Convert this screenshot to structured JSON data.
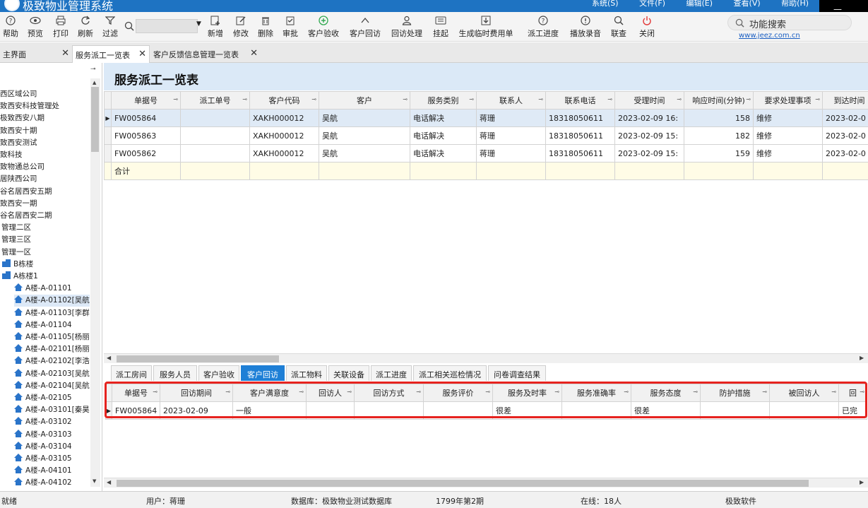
{
  "titlebar": {
    "app_title": "极致物业管理系统",
    "menu": [
      "系统(S)",
      "文件(F)",
      "编辑(E)",
      "查看(V)",
      "帮助(H)"
    ]
  },
  "toolbar": {
    "items": [
      {
        "label": "帮助",
        "icon": "help-icon"
      },
      {
        "label": "预览",
        "icon": "preview-icon"
      },
      {
        "label": "打印",
        "icon": "print-icon"
      },
      {
        "label": "刷新",
        "icon": "refresh-icon"
      },
      {
        "label": "过滤",
        "icon": "filter-icon"
      },
      {
        "label": "新增",
        "icon": "add-icon"
      },
      {
        "label": "修改",
        "icon": "edit-icon"
      },
      {
        "label": "删除",
        "icon": "delete-icon"
      },
      {
        "label": "审批",
        "icon": "approve-icon"
      },
      {
        "label": "客户验收",
        "icon": "plus-circle-icon"
      },
      {
        "label": "客户回访",
        "icon": "chevron-up-icon"
      },
      {
        "label": "回访处理",
        "icon": "user-icon"
      },
      {
        "label": "挂起",
        "icon": "keyboard-icon"
      },
      {
        "label": "生成临时费用单",
        "icon": "download-icon"
      },
      {
        "label": "派工进度",
        "icon": "help-icon"
      },
      {
        "label": "播放录音",
        "icon": "info-icon"
      },
      {
        "label": "联查",
        "icon": "search-icon"
      },
      {
        "label": "关闭",
        "icon": "power-icon"
      }
    ],
    "function_search": "功能搜索",
    "website": "www.jeez.com.cn"
  },
  "tabs": [
    {
      "label": "主界面"
    },
    {
      "label": "服务派工一览表"
    },
    {
      "label": "客户反馈信息管理一览表"
    }
  ],
  "sidebar": {
    "items": [
      "西区域公司",
      "致西安科技管理处",
      "极致西安八期",
      "致西安十期",
      "致西安测试",
      "致科技",
      "致物通总公司",
      "居陕西公司",
      "谷名居西安五期",
      "致西安一期",
      "谷名居西安二期",
      "管理二区",
      "管理三区",
      "管理一区",
      "B栋楼",
      "A栋楼1",
      "A楼-A-01101",
      "A楼-A-01102[吴航",
      "A楼-A-01103[李群",
      "A楼-A-01104",
      "A楼-A-01105[杨丽",
      "A楼-A-02101[杨丽",
      "A楼-A-02102[李浩",
      "A楼-A-02103[吴航",
      "A楼-A-02104[吴航",
      "A楼-A-02105",
      "A楼-A-03101[秦昊",
      "A楼-A-03102",
      "A楼-A-03103",
      "A楼-A-03104",
      "A楼-A-03105",
      "A楼-A-04101",
      "A楼-A-04102"
    ]
  },
  "page_title": "服务派工一览表",
  "main_grid": {
    "columns": [
      "单据号",
      "派工单号",
      "客户代码",
      "客户",
      "服务类别",
      "联系人",
      "联系电话",
      "受理时间",
      "响应时间(分钟)",
      "要求处理事项",
      "到达时间"
    ],
    "rows": [
      [
        "FW005864",
        "",
        "XAKH000012",
        "吴航",
        "电话解决",
        "蒋珊",
        "18318050611",
        "2023-02-09 16:",
        "158",
        "维修",
        "2023-02-0"
      ],
      [
        "FW005863",
        "",
        "XAKH000012",
        "吴航",
        "电话解决",
        "蒋珊",
        "18318050611",
        "2023-02-09 15:",
        "182",
        "维修",
        "2023-02-0"
      ],
      [
        "FW005862",
        "",
        "XAKH000012",
        "吴航",
        "电话解决",
        "蒋珊",
        "18318050611",
        "2023-02-09 15:",
        "159",
        "维修",
        "2023-02-0"
      ]
    ],
    "sum_label": "合计"
  },
  "sub_tabs": [
    "派工房间",
    "服务人员",
    "客户验收",
    "客户回访",
    "派工物料",
    "关联设备",
    "派工进度",
    "派工相关巡检情况",
    "问卷调查结果"
  ],
  "sub_grid": {
    "columns": [
      "单据号",
      "回访期间",
      "客户满意度",
      "回访人",
      "回访方式",
      "服务评价",
      "服务及时率",
      "服务准确率",
      "服务态度",
      "防护措施",
      "被回访人",
      "回"
    ],
    "rows": [
      [
        "FW005864",
        "2023-02-09",
        "一般",
        "",
        "",
        "",
        "很差",
        "",
        "很差",
        "",
        "",
        "已完"
      ]
    ]
  },
  "statusbar": {
    "status": "就绪",
    "user": "用户：蒋珊",
    "database": "数据库：极致物业测试数据库",
    "period": "1799年第2期",
    "online": "在线：18人",
    "company": "极致软件"
  },
  "colors": {
    "accent": "#1e73c2",
    "active_subtab": "#1e7fd6",
    "highlight_box": "#e6231f",
    "title_band": "#dbe9f7"
  }
}
